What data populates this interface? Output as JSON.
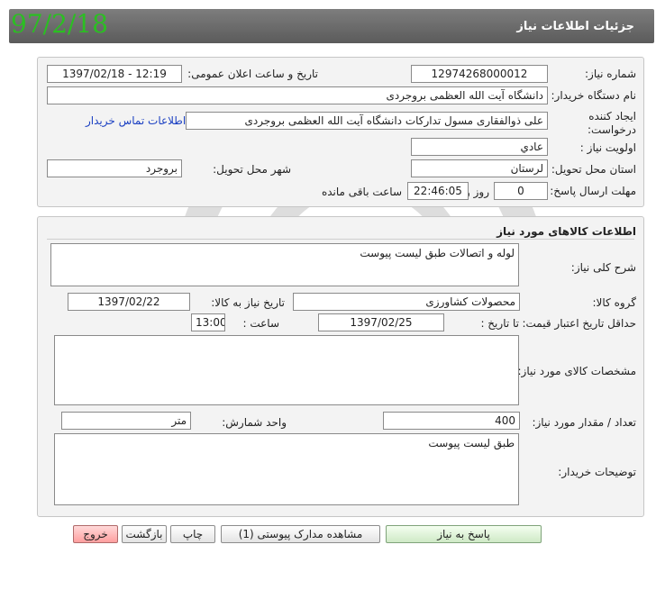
{
  "header": {
    "title": "جزئیات اطلاعات نیاز",
    "date_stamp": "97/2/18",
    "bar_color": "#6a6a6a",
    "stamp_color": "#2bbf22"
  },
  "need_info": {
    "need_number_label": "شماره نیاز:",
    "need_number_value": "12974268000012",
    "announce_datetime_label": "تاریخ و ساعت اعلان عمومی:",
    "announce_datetime_value": "1397/02/18 - 12:19",
    "buyer_org_label": "نام دستگاه خریدار:",
    "buyer_org_value": "دانشگاه آیت الله العظمی بروجردی",
    "creator_label_line1": "ایجاد کننده",
    "creator_label_line2": "درخواست:",
    "creator_value": "علی ذوالفقاری مسول تدارکات دانشگاه آیت الله العظمی بروجردی",
    "contact_link": "اطلاعات تماس خریدار",
    "priority_label": "اولویت نیاز :",
    "priority_value": "عادي",
    "province_label": "استان محل تحویل:",
    "province_value": "لرستان",
    "city_label": "شهر محل تحویل:",
    "city_value": "بروجرد",
    "deadline_label": "مهلت ارسال پاسخ:",
    "deadline_days_value": "0",
    "deadline_days_unit": "روز و",
    "deadline_time_value": "22:46:05",
    "deadline_remaining": "ساعت باقی مانده"
  },
  "goods": {
    "section_title": "اطلاعات کالاهای مورد نیاز",
    "general_desc_label": "شرح کلی نیاز:",
    "general_desc_value": "لوله و اتصالات طبق لیست پیوست",
    "goods_group_label": "گروه کالا:",
    "goods_group_value": "محصولات کشاورزی",
    "need_date_label": "تاریخ نیاز به کالا:",
    "need_date_value": "1397/02/22",
    "price_validity_label": "حداقل تاریخ اعتبار قیمت:",
    "until_date_label": "تا تاریخ :",
    "until_date_value": "1397/02/25",
    "time_label": "ساعت :",
    "time_value": "13:00",
    "specs_label": "مشخصات کالای مورد نیاز:",
    "specs_value": "",
    "quantity_label": "تعداد / مقدار مورد نیاز:",
    "quantity_value": "400",
    "unit_label": "واحد شمارش:",
    "unit_value": "متر",
    "buyer_notes_label": "توضیحات خریدار:",
    "buyer_notes_value": "طبق لیست پیوست"
  },
  "actions": {
    "reply": "پاسخ به نیاز",
    "view_attachments": "مشاهده مدارک پیوستی (1)",
    "print": "چاپ",
    "back": "بازگشت",
    "exit": "خروج"
  },
  "watermark": {
    "line1": "هزاره",
    "line2": "گستران",
    "line3": "ارتباط"
  }
}
